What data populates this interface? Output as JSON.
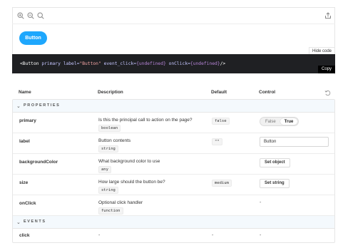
{
  "toolbar": {
    "icons": [
      "zoom-in-icon",
      "zoom-out-icon",
      "zoom-reset-icon",
      "share-icon"
    ]
  },
  "preview": {
    "button_label": "Button"
  },
  "code": {
    "hide_label": "Hide code",
    "copy_label": "Copy",
    "tag_open": "<Button",
    "attr_primary": "primary",
    "attr_label": "label=",
    "label_value": "\"Button\"",
    "attr_event": "event_click=",
    "event_value": "{undefined}",
    "attr_onclick": "onClick=",
    "onclick_value": "{undefined}",
    "tag_close": "/>"
  },
  "table": {
    "headers": {
      "name": "Name",
      "description": "Description",
      "default": "Default",
      "control": "Control"
    },
    "sections": {
      "properties": "PROPERTIES",
      "events": "EVENTS"
    },
    "rows": {
      "primary": {
        "name": "primary",
        "description": "Is this the principal call to action on the page?",
        "type": "boolean",
        "default": "false",
        "control_false": "False",
        "control_true": "True"
      },
      "label": {
        "name": "label",
        "description": "Button contents",
        "type": "string",
        "default": "\"\"",
        "control_value": "Button"
      },
      "backgroundColor": {
        "name": "backgroundColor",
        "description": "What background color to use",
        "type": "any",
        "control_button": "Set object"
      },
      "size": {
        "name": "size",
        "description": "How large should the button be?",
        "type": "string",
        "default": "medium",
        "control_button": "Set string"
      },
      "onClick": {
        "name": "onClick",
        "description": "Optional click handler",
        "type": "function",
        "control": "-"
      },
      "click": {
        "name": "click",
        "description": "-",
        "default": "-",
        "control": "-"
      }
    }
  },
  "colors": {
    "primary_button": "#1ea7fd",
    "code_background": "#1f2023",
    "section_background": "#f4f9fd"
  }
}
